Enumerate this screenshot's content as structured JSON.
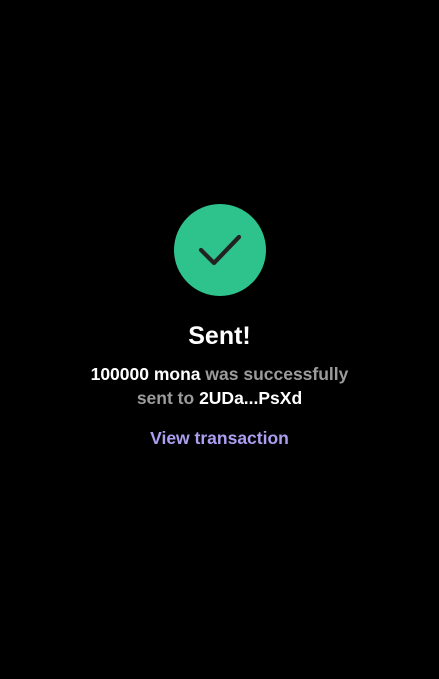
{
  "status": {
    "icon": "checkmark-icon",
    "circle_color": "#2ec28c",
    "check_color": "#222222"
  },
  "title": "Sent!",
  "message": {
    "amount": "100000 mona",
    "middle_text": " was successfully",
    "sent_to": "sent to ",
    "recipient": "2UDa...PsXd"
  },
  "view_transaction_label": "View transaction",
  "colors": {
    "background": "#000000",
    "link": "#ab9ff2",
    "muted_text": "#9b9b9b"
  }
}
